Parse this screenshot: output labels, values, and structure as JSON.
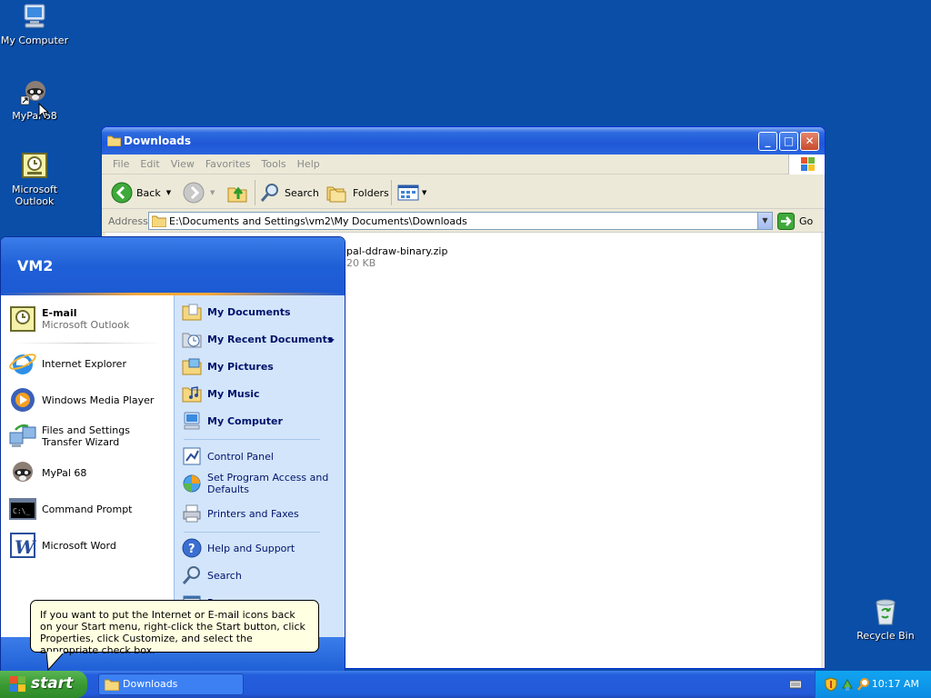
{
  "desktop": {
    "icons": [
      {
        "label": "My Computer"
      },
      {
        "label": "MyPal 68"
      },
      {
        "label": "Microsoft Outlook"
      },
      {
        "label": "Recycle Bin"
      }
    ]
  },
  "window": {
    "title": "Downloads",
    "menu": [
      "File",
      "Edit",
      "View",
      "Favorites",
      "Tools",
      "Help"
    ],
    "toolbar": {
      "back": "Back",
      "search": "Search",
      "folders": "Folders"
    },
    "address_label": "Address",
    "address_value": "E:\\Documents and Settings\\vm2\\My Documents\\Downloads",
    "go_label": "Go",
    "file": {
      "name": "pal-ddraw-binary.zip",
      "size": "20 KB"
    }
  },
  "start_menu": {
    "user": "VM2",
    "pinned": {
      "title": "E-mail",
      "subtitle": "Microsoft Outlook"
    },
    "programs": [
      "Internet Explorer",
      "Windows Media Player",
      "Files and Settings Transfer Wizard",
      "MyPal 68",
      "Command Prompt",
      "Microsoft Word"
    ],
    "places": [
      "My Documents",
      "My Recent Documents",
      "My Pictures",
      "My Music",
      "My Computer"
    ],
    "settings": [
      "Control Panel",
      "Set Program Access and Defaults",
      "Printers and Faxes"
    ],
    "help": [
      "Help and Support",
      "Search",
      "Run..."
    ]
  },
  "balloon": {
    "text": "If you want to put the Internet or E-mail icons back on your Start menu, right-click the Start button, click Properties, click Customize, and select the appropriate check box."
  },
  "taskbar": {
    "start_label": "start",
    "task_label": "Downloads",
    "clock": "10:17 AM"
  }
}
